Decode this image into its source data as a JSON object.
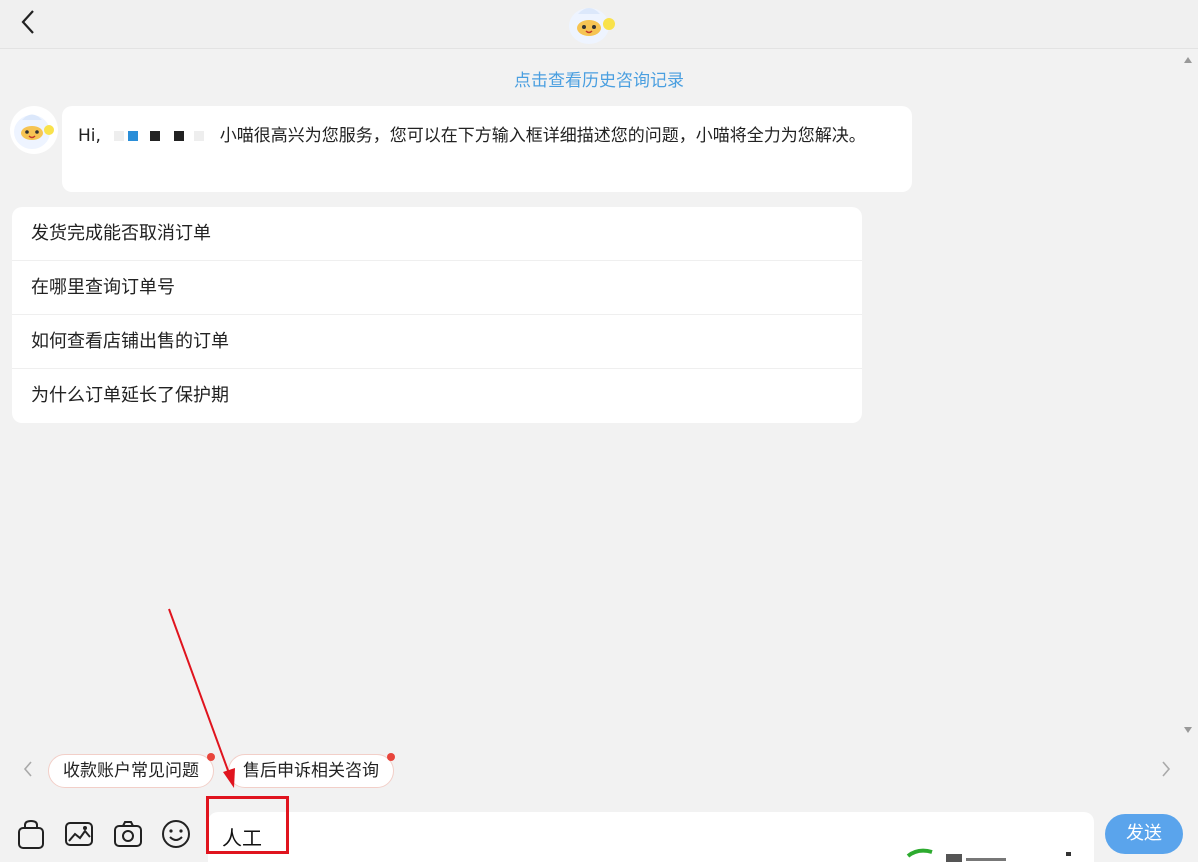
{
  "header": {
    "back_icon": "chevron-left-icon",
    "logo_icon": "cat-mascot-logo"
  },
  "history_link": "点击查看历史咨询记录",
  "greeting": {
    "prefix": "Hi,",
    "message": "小喵很高兴为您服务，您可以在下方输入框详细描述您的问题，小喵将全力为您解决。"
  },
  "faq": [
    {
      "label": "发货完成能否取消订单"
    },
    {
      "label": "在哪里查询订单号"
    },
    {
      "label": "如何查看店铺出售的订单"
    },
    {
      "label": "为什么订单延长了保护期"
    }
  ],
  "quick_chips": [
    {
      "label": "收款账户常见问题"
    },
    {
      "label": "售后申诉相关咨询"
    }
  ],
  "toolbar": {
    "icons": [
      "shopping-bag-icon",
      "image-icon",
      "camera-icon",
      "emoji-icon"
    ]
  },
  "input": {
    "value": "人工"
  },
  "send_label": "发送",
  "colors": {
    "link": "#4a9fe0",
    "send_button": "#5aa4ec",
    "annotation": "#e0141e",
    "badge": "#e8453c"
  }
}
